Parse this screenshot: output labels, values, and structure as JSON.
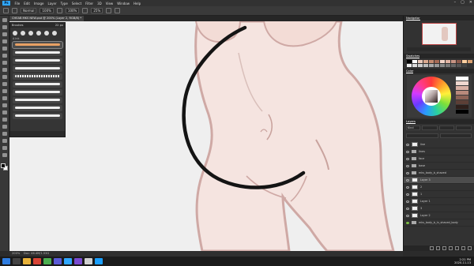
{
  "app": {
    "logo": "Ps"
  },
  "menu": [
    "File",
    "Edit",
    "Image",
    "Layer",
    "Type",
    "Select",
    "Filter",
    "3D",
    "View",
    "Window",
    "Help"
  ],
  "window_controls": [
    "–",
    "▢",
    "✕"
  ],
  "options": {
    "mode": "Normal",
    "opacity": "100%",
    "flow": "100%",
    "smoothing": "25%"
  },
  "document_tab": "CHEAB MKS NEW.psd @ 200% (Layer 2, RGB/8) *",
  "brushes_panel": {
    "title": "Brushes",
    "size": "22 px",
    "group": "A Ink"
  },
  "panels": {
    "navigator": "Navigator",
    "swatches": "Swatches",
    "color": "Color",
    "layers": "Layers"
  },
  "layers": {
    "filter": "Kind",
    "items": [
      {
        "name": "line",
        "type": "layer"
      },
      {
        "name": "lines",
        "type": "group"
      },
      {
        "name": "face",
        "type": "group"
      },
      {
        "name": "base",
        "type": "group"
      },
      {
        "name": "mks_body_b_shaved",
        "type": "group"
      },
      {
        "name": "Layer 3",
        "type": "layer",
        "selected": true
      },
      {
        "name": "2",
        "type": "layer"
      },
      {
        "name": "1",
        "type": "layer"
      },
      {
        "name": "Layer 1",
        "type": "layer"
      },
      {
        "name": "3",
        "type": "layer"
      },
      {
        "name": "Layer 2",
        "type": "layer"
      },
      {
        "name": "mks_body_b_ln_shaved_body",
        "type": "group"
      }
    ]
  },
  "status": {
    "zoom": "200%",
    "doc": "Doc: 46.4M/1.53G"
  },
  "taskbar": {
    "time": "2:21 PM",
    "date": "2020-11-13"
  },
  "colors": {
    "accent": "#31a8ff",
    "canvas": "#efefef",
    "skin": "#f5e4e0",
    "outline": "#cfa9a5",
    "stroke": "#141414"
  }
}
